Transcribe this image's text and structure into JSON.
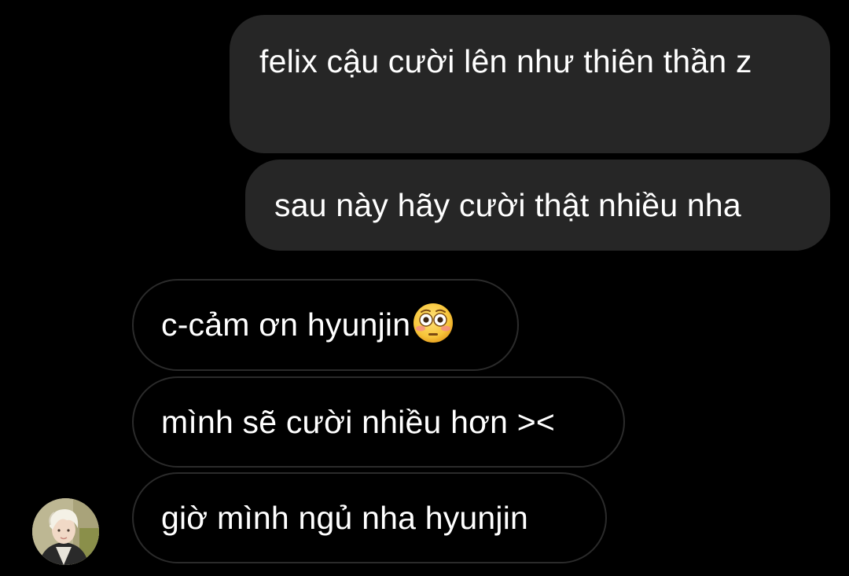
{
  "conversation": {
    "messages": [
      {
        "direction": "outgoing",
        "text": "felix cậu cười lên như thiên thần z"
      },
      {
        "direction": "outgoing",
        "text": "sau này hãy cười thật nhiều nha"
      },
      {
        "direction": "incoming",
        "text": "c-cảm ơn hyunjin",
        "emoji": "flushed-face-emoji"
      },
      {
        "direction": "incoming",
        "text": "mình sẽ cười nhiều hơn ><"
      },
      {
        "direction": "incoming",
        "text": "giờ mình ngủ nha hyunjin"
      }
    ],
    "sender_avatar": "avatar-photo"
  },
  "colors": {
    "background": "#000000",
    "outgoing_bubble": "#262626",
    "incoming_border": "#2b2b2b",
    "text": "#ffffff",
    "emoji_face": "#f7c53a"
  }
}
